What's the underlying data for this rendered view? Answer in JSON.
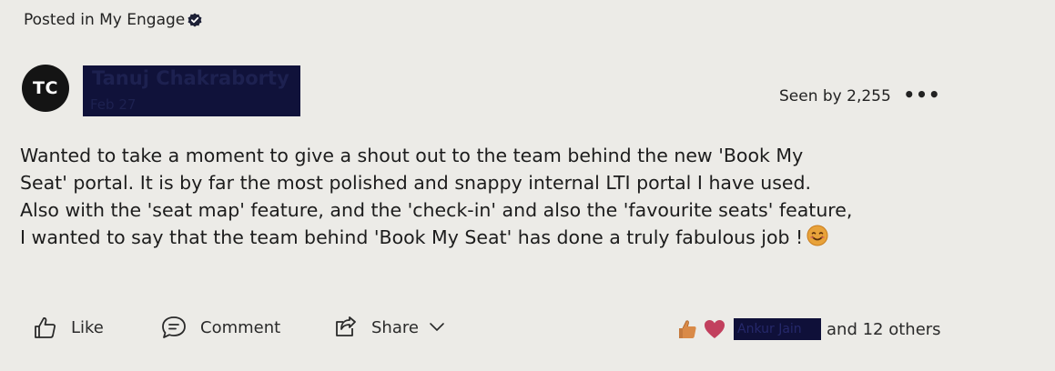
{
  "post": {
    "posted_in": "Posted in My Engage",
    "avatar_initials": "TC",
    "author_name": "Tanuj Chakraborty",
    "date": "Feb 27",
    "seen_by": "Seen by 2,255",
    "more_label": "•••",
    "body_lines": [
      "Wanted to take a moment to give a shout out to the team behind the new 'Book My",
      "Seat' portal. It is by far the most polished and snappy internal LTI portal I have used.",
      "Also with the 'seat map' feature, and the 'check-in' and also the 'favourite seats' feature,",
      "I wanted to say that the team behind 'Book My Seat' has done a truly fabulous job !"
    ]
  },
  "actions": {
    "like": "Like",
    "comment": "Comment",
    "share": "Share"
  },
  "reactions": {
    "first_reactor": "Ankur Jain",
    "others": "and 12 others"
  },
  "colors": {
    "background": "#ecebe7",
    "redaction": "#10123a",
    "avatar": "#141414"
  }
}
